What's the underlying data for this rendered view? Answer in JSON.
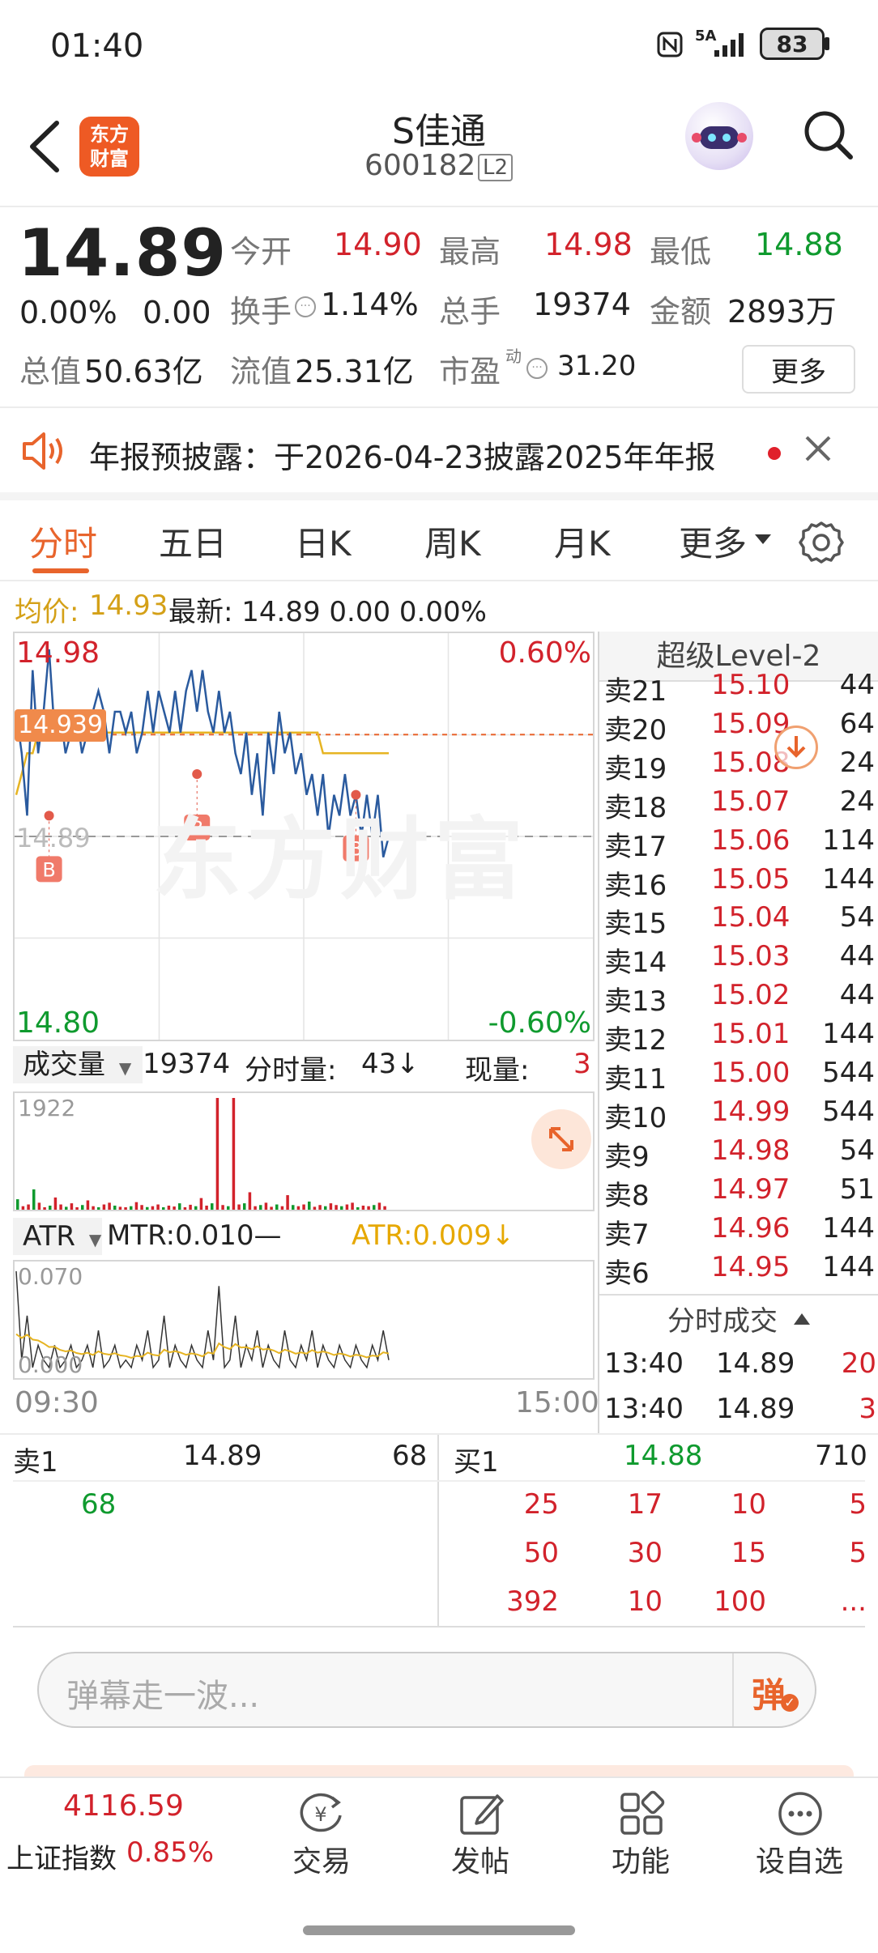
{
  "status": {
    "time": "01:40",
    "network": "5A",
    "battery": "83"
  },
  "header": {
    "title": "S佳通",
    "code": "600182",
    "level_badge": "L2",
    "logo_text_1": "东方",
    "logo_text_2": "财富"
  },
  "quote": {
    "price": "14.89",
    "change_pct": "0.00%",
    "change": "0.00",
    "open_label": "今开",
    "open": "14.90",
    "high_label": "最高",
    "high": "14.98",
    "low_label": "最低",
    "low": "14.88",
    "turnover_label": "换手",
    "turnover": "1.14%",
    "vol_label": "总手",
    "vol": "19374",
    "amount_label": "金额",
    "amount": "2893万",
    "mcap_label": "总值",
    "mcap": "50.63亿",
    "float_label": "流值",
    "float": "25.31亿",
    "pe_label": "市盈",
    "pe_sup": "动",
    "pe": "31.20",
    "more": "更多"
  },
  "notice": {
    "text": "年报预披露：于2026-04-23披露2025年年报"
  },
  "tabs": [
    "分时",
    "五日",
    "日K",
    "周K",
    "月K",
    "更多"
  ],
  "info_bar": {
    "avg_label": "均价:",
    "avg": "14.93",
    "latest": "最新: 14.89 0.00 0.00%"
  },
  "chart": {
    "y_top": "14.98",
    "y_bottom": "14.80",
    "pct_top": "0.60%",
    "pct_bottom": "-0.60%",
    "mid_label": "14.89",
    "ref_tag": "14.939",
    "marker": "B",
    "watermark": "东方财富",
    "vol_selector": "成交量",
    "vol_total": "19374",
    "tick_vol_label": "分时量:",
    "tick_vol": "43↓",
    "cur_label": "现量:",
    "cur_vol": "3",
    "vol_max": "1922",
    "atr_selector": "ATR",
    "mtr": "MTR:0.010—",
    "atr": "ATR:0.009↓",
    "atr_max": "0.070",
    "atr_min": "0.000",
    "time_start": "09:30",
    "time_end": "15:00"
  },
  "chart_data": {
    "type": "line",
    "title": "",
    "ylim": [
      14.8,
      14.98
    ],
    "xlim": [
      "09:30",
      "15:00"
    ],
    "reference_price": 14.89,
    "series": [
      {
        "name": "最新",
        "values": [
          14.95,
          14.93,
          14.9,
          14.97,
          14.93,
          14.95,
          14.98,
          14.94,
          14.95,
          14.93,
          14.94,
          14.95,
          14.93,
          14.94,
          14.95,
          14.96,
          14.95,
          14.93,
          14.95,
          14.95,
          14.94,
          14.95,
          14.93,
          14.94,
          14.96,
          14.94,
          14.96,
          14.95,
          14.94,
          14.96,
          14.94,
          14.96,
          14.97,
          14.95,
          14.97,
          14.95,
          14.94,
          14.96,
          14.94,
          14.95,
          14.93,
          14.92,
          14.94,
          14.91,
          14.93,
          14.9,
          14.94,
          14.92,
          14.95,
          14.93,
          14.94,
          14.92,
          14.93,
          14.91,
          14.92,
          14.9,
          14.92,
          14.89,
          14.91,
          14.9,
          14.92,
          14.9,
          14.91,
          14.89,
          14.91,
          14.89,
          14.91,
          14.88,
          14.89
        ]
      },
      {
        "name": "均价",
        "values": [
          14.91,
          14.92,
          14.93,
          14.93,
          14.94,
          14.94,
          14.94,
          14.94,
          14.94,
          14.94,
          14.94,
          14.94,
          14.94,
          14.94,
          14.94,
          14.94,
          14.94,
          14.94,
          14.94,
          14.94,
          14.94,
          14.94,
          14.94,
          14.94,
          14.94,
          14.94,
          14.94,
          14.94,
          14.94,
          14.94,
          14.94,
          14.94,
          14.94,
          14.94,
          14.94,
          14.94,
          14.94,
          14.94,
          14.94,
          14.94,
          14.94,
          14.94,
          14.94,
          14.94,
          14.94,
          14.94,
          14.94,
          14.94,
          14.94,
          14.94,
          14.94,
          14.94,
          14.94,
          14.94,
          14.94,
          14.94,
          14.93,
          14.93,
          14.93,
          14.93,
          14.93,
          14.93,
          14.93,
          14.93,
          14.93,
          14.93,
          14.93,
          14.93,
          14.93
        ]
      }
    ],
    "volume_max": 1922
  },
  "orderbook": {
    "title": "超级Level-2",
    "asks": [
      {
        "label": "卖21",
        "price": "15.10",
        "vol": "44"
      },
      {
        "label": "卖20",
        "price": "15.09",
        "vol": "64"
      },
      {
        "label": "卖19",
        "price": "15.08",
        "vol": "24"
      },
      {
        "label": "卖18",
        "price": "15.07",
        "vol": "24"
      },
      {
        "label": "卖17",
        "price": "15.06",
        "vol": "114"
      },
      {
        "label": "卖16",
        "price": "15.05",
        "vol": "144"
      },
      {
        "label": "卖15",
        "price": "15.04",
        "vol": "54"
      },
      {
        "label": "卖14",
        "price": "15.03",
        "vol": "44"
      },
      {
        "label": "卖13",
        "price": "15.02",
        "vol": "44"
      },
      {
        "label": "卖12",
        "price": "15.01",
        "vol": "144"
      },
      {
        "label": "卖11",
        "price": "15.00",
        "vol": "544"
      },
      {
        "label": "卖10",
        "price": "14.99",
        "vol": "544"
      },
      {
        "label": "卖9",
        "price": "14.98",
        "vol": "54"
      },
      {
        "label": "卖8",
        "price": "14.97",
        "vol": "51"
      },
      {
        "label": "卖7",
        "price": "14.96",
        "vol": "144"
      },
      {
        "label": "卖6",
        "price": "14.95",
        "vol": "144"
      }
    ],
    "trades_title": "分时成交",
    "trades": [
      {
        "time": "13:40",
        "price": "14.89",
        "vol": "20"
      },
      {
        "time": "13:40",
        "price": "14.89",
        "vol": "3"
      }
    ]
  },
  "queue": {
    "sell_label": "卖1",
    "sell_price": "14.89",
    "sell_vol": "68",
    "buy_label": "买1",
    "buy_price": "14.88",
    "buy_vol": "710",
    "sell_orders": [
      "68"
    ],
    "buy_orders": [
      [
        "25",
        "17",
        "10",
        "5"
      ],
      [
        "50",
        "30",
        "15",
        "5"
      ],
      [
        "392",
        "10",
        "100",
        "..."
      ]
    ]
  },
  "danmu": {
    "placeholder": "弹幕走一波...",
    "button": "弹"
  },
  "bottom_nav": {
    "index_value": "4116.59",
    "index_name": "上证指数",
    "index_pct": "0.85%",
    "trade": "交易",
    "post": "发帖",
    "func": "功能",
    "watch": "设自选"
  },
  "colors": {
    "accent": "#e8642c",
    "up": "#d2222b",
    "down": "#0f9a2e",
    "avg_line": "#e6b422",
    "price_line": "#2a5a9e"
  }
}
